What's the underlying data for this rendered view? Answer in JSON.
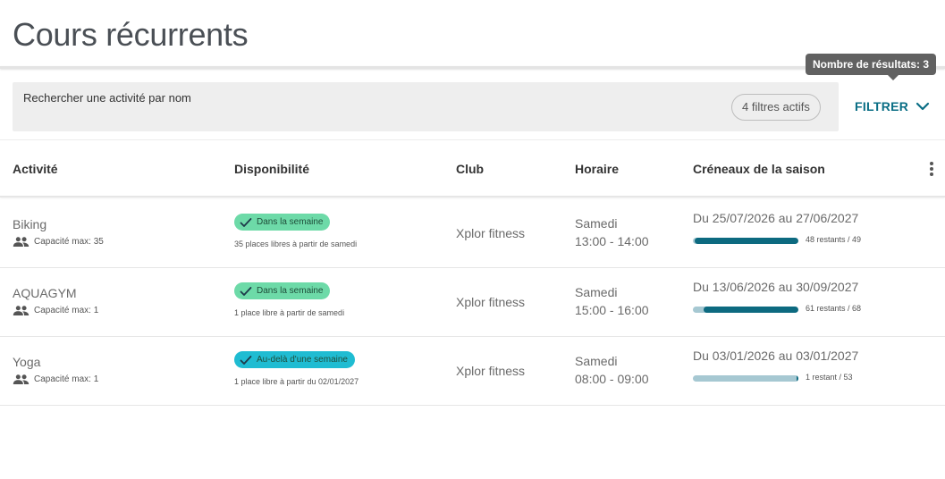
{
  "page": {
    "title": "Cours récurrents"
  },
  "tooltip": {
    "text": "Nombre de résultats: 3"
  },
  "search": {
    "placeholder": "Rechercher une activité par nom",
    "filters_chip": "4 filtres actifs"
  },
  "filter_button": {
    "label": "FILTRER",
    "icon": "chevron-down-icon"
  },
  "table": {
    "headers": [
      "Activité",
      "Disponibilité",
      "Club",
      "Horaire",
      "Créneaux de la saison"
    ],
    "more_icon": "more-vert-icon",
    "rows": [
      {
        "activity": "Biking",
        "capacity": "Capacité max: 35",
        "badge": "Dans la semaine",
        "badge_color": "#6ddaa8",
        "availability_note": "35 places libres à partir de samedi",
        "club": "Xplor fitness",
        "day": "Samedi",
        "time": "13:00 - 14:00",
        "season": "Du 25/07/2026 au 27/06/2027",
        "remaining_fraction": 0.98,
        "remaining_label": "48 restants / 49"
      },
      {
        "activity": "AQUAGYM",
        "capacity": "Capacité max: 1",
        "badge": "Dans la semaine",
        "badge_color": "#6ddaa8",
        "availability_note": "1 place libre à partir de samedi",
        "club": "Xplor fitness",
        "day": "Samedi",
        "time": "15:00 - 16:00",
        "season": "Du 13/06/2026 au 30/09/2027",
        "remaining_fraction": 0.897,
        "remaining_label": "61 restants / 68"
      },
      {
        "activity": "Yoga",
        "capacity": "Capacité max: 1",
        "badge": "Au-delà d'une semaine",
        "badge_color": "#1fbcd2",
        "availability_note": "1 place libre à partir du 02/01/2027",
        "club": "Xplor fitness",
        "day": "Samedi",
        "time": "08:00 - 09:00",
        "season": "Du 03/01/2026 au 03/01/2027",
        "remaining_fraction": 0.019,
        "remaining_label": "1 restant / 53"
      }
    ]
  },
  "colors": {
    "accent": "#0a6e85",
    "progress_fill": "#0d6a80",
    "progress_track": "#a6c8d2"
  }
}
